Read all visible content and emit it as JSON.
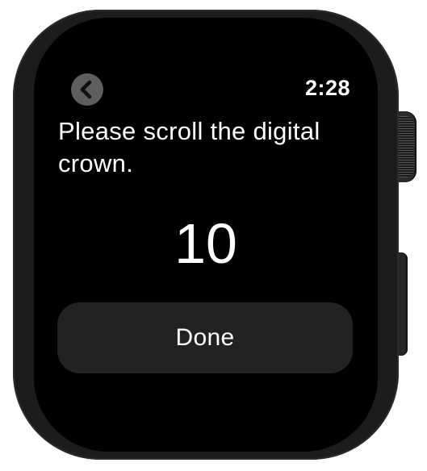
{
  "status_bar": {
    "time": "2:28"
  },
  "navigation": {
    "back_icon": "chevron-left-icon"
  },
  "main": {
    "prompt": "Please scroll the digital crown.",
    "crown_value": "10",
    "done_label": "Done"
  },
  "colors": {
    "screen_background": "#000000",
    "back_button": "#5e5e5e",
    "done_button": "#222222",
    "text": "#ffffff"
  }
}
